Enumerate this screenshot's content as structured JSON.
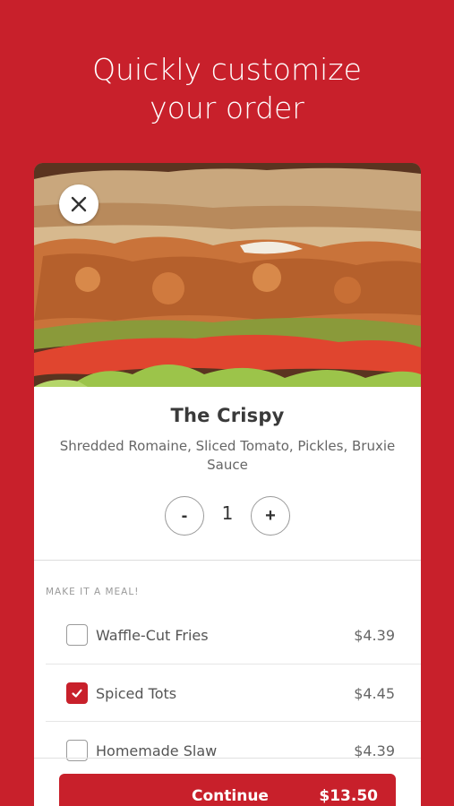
{
  "headline": {
    "line1": "Quickly customize",
    "line2": "your order"
  },
  "item": {
    "name": "The Crispy",
    "description": "Shredded Romaine, Sliced Tomato, Pickles, Bruxie Sauce",
    "quantity": "1",
    "decrease_label": "-",
    "increase_label": "+"
  },
  "meal": {
    "section_label": "MAKE IT A MEAL!",
    "options": [
      {
        "label": "Waffle-Cut Fries",
        "price": "$4.39",
        "checked": false
      },
      {
        "label": "Spiced Tots",
        "price": "$4.45",
        "checked": true
      },
      {
        "label": "Homemade Slaw",
        "price": "$4.39",
        "checked": false
      }
    ]
  },
  "footer": {
    "continue_label": "Continue",
    "total": "$13.50"
  },
  "colors": {
    "brand_red": "#c8202b",
    "text_dark": "#3a3a3a",
    "text_muted": "#666666"
  },
  "icons": {
    "close": "close-icon",
    "check": "check-icon"
  }
}
